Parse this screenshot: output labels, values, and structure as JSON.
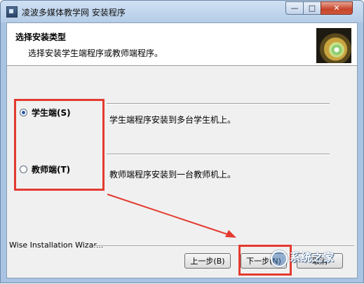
{
  "window": {
    "title": "凌波多媒体教学网 安装程序",
    "minimize_label": "—",
    "maximize_label": "□",
    "close_label": "✕"
  },
  "header": {
    "title": "选择安装类型",
    "subtitle": "选择安装学生端程序或教师端程序。"
  },
  "options": [
    {
      "label": "学生端(S)",
      "description": "学生端程序安装到多台学生机上。",
      "selected": true
    },
    {
      "label": "教师端(T)",
      "description": "教师端程序安装到一台教师机上。",
      "selected": false
    }
  ],
  "footer": {
    "wizard_text": "Wise Installation Wizar...",
    "back_label": "上一步(B)",
    "next_label": "下一步(N)",
    "cancel_label": "取消"
  },
  "watermark": {
    "text": "系统之家"
  },
  "colors": {
    "annotation_red": "#e33b2f",
    "title_bar": "#b6cde8"
  }
}
